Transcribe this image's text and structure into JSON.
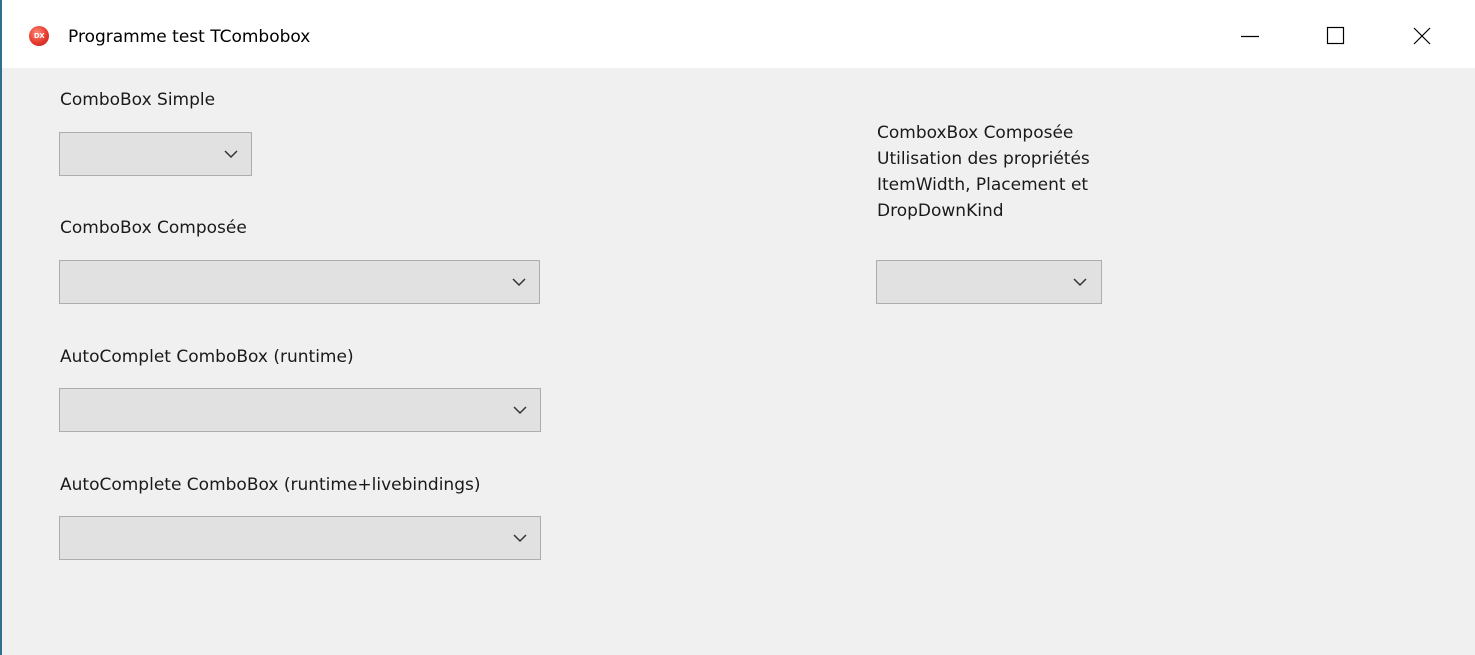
{
  "window": {
    "title": "Programme test TCombobox",
    "app_icon_text": "DX"
  },
  "caption_buttons": {
    "minimize": "minimize",
    "maximize": "maximize",
    "close": "close"
  },
  "form": {
    "simple_label": "ComboBox Simple",
    "simple_value": "",
    "composed_label": "ComboBox Composée",
    "composed_value": "",
    "autocomplet_label": "AutoComplet ComboBox (runtime)",
    "autocomplet_value": "",
    "autocomplete_lb_label": "AutoComplete ComboBox (runtime+livebindings)",
    "autocomplete_lb_value": "",
    "composed2_label_lines": [
      "ComboxBox Composée",
      "Utilisation des propriétés",
      "ItemWidth, Placement et",
      "DropDownKind"
    ],
    "composed2_value": ""
  },
  "colors": {
    "title_bar": "#ffffff",
    "client_bg": "#f0f0f0",
    "combo_bg": "#e1e1e1",
    "combo_border": "#adadad",
    "window_border": "#2f6f8f",
    "app_icon": "#e63a2d"
  },
  "icons": {
    "app": "delphi-app-icon",
    "minimize": "minimize-icon",
    "maximize": "maximize-icon",
    "close": "close-icon",
    "dropdown": "chevron-down-icon"
  }
}
